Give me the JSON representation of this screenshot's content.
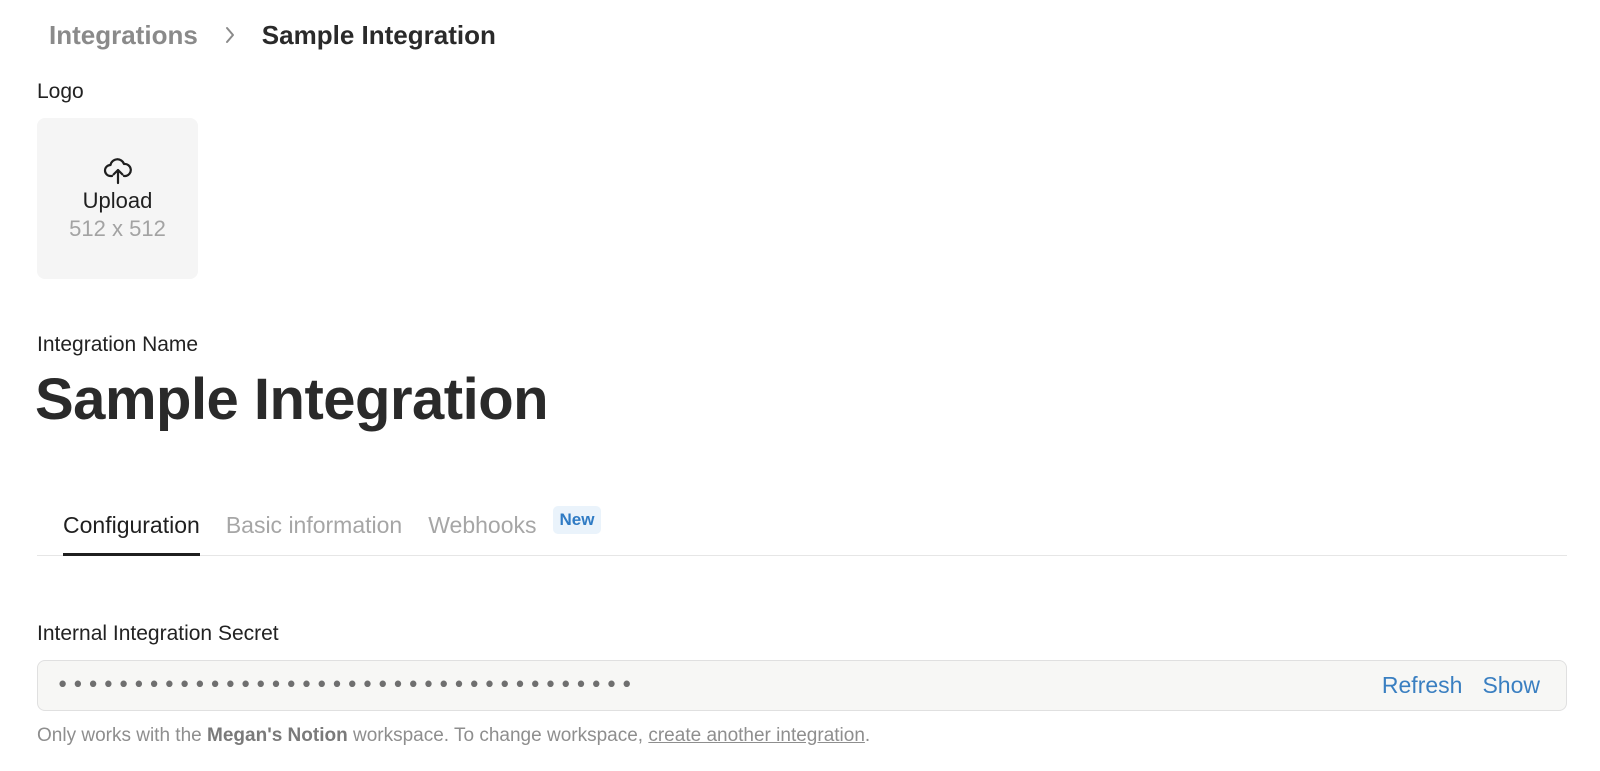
{
  "breadcrumb": {
    "parent": "Integrations",
    "current": "Sample Integration"
  },
  "logo": {
    "label": "Logo",
    "upload_label": "Upload",
    "size_hint": "512 x 512"
  },
  "integration_name": {
    "label": "Integration Name",
    "value": "Sample Integration"
  },
  "tabs": [
    {
      "label": "Configuration",
      "active": true
    },
    {
      "label": "Basic information",
      "active": false
    },
    {
      "label": "Webhooks",
      "active": false,
      "badge": "New"
    }
  ],
  "secret": {
    "label": "Internal Integration Secret",
    "masked_value": "••••••••••••••••••••••••••••••••••••••",
    "refresh_label": "Refresh",
    "show_label": "Show"
  },
  "helper": {
    "prefix": "Only works with the",
    "workspace": "Megan's Notion",
    "middle": "workspace. To change workspace,",
    "link": "create another integration",
    "suffix": "."
  },
  "colors": {
    "link": "#3a7fc1",
    "badge_bg": "#eaf3fb",
    "active_tab_underline": "#1f1f1f"
  },
  "icons": {
    "breadcrumb_separator": "chevron-right-icon",
    "upload": "cloud-upload-icon"
  }
}
